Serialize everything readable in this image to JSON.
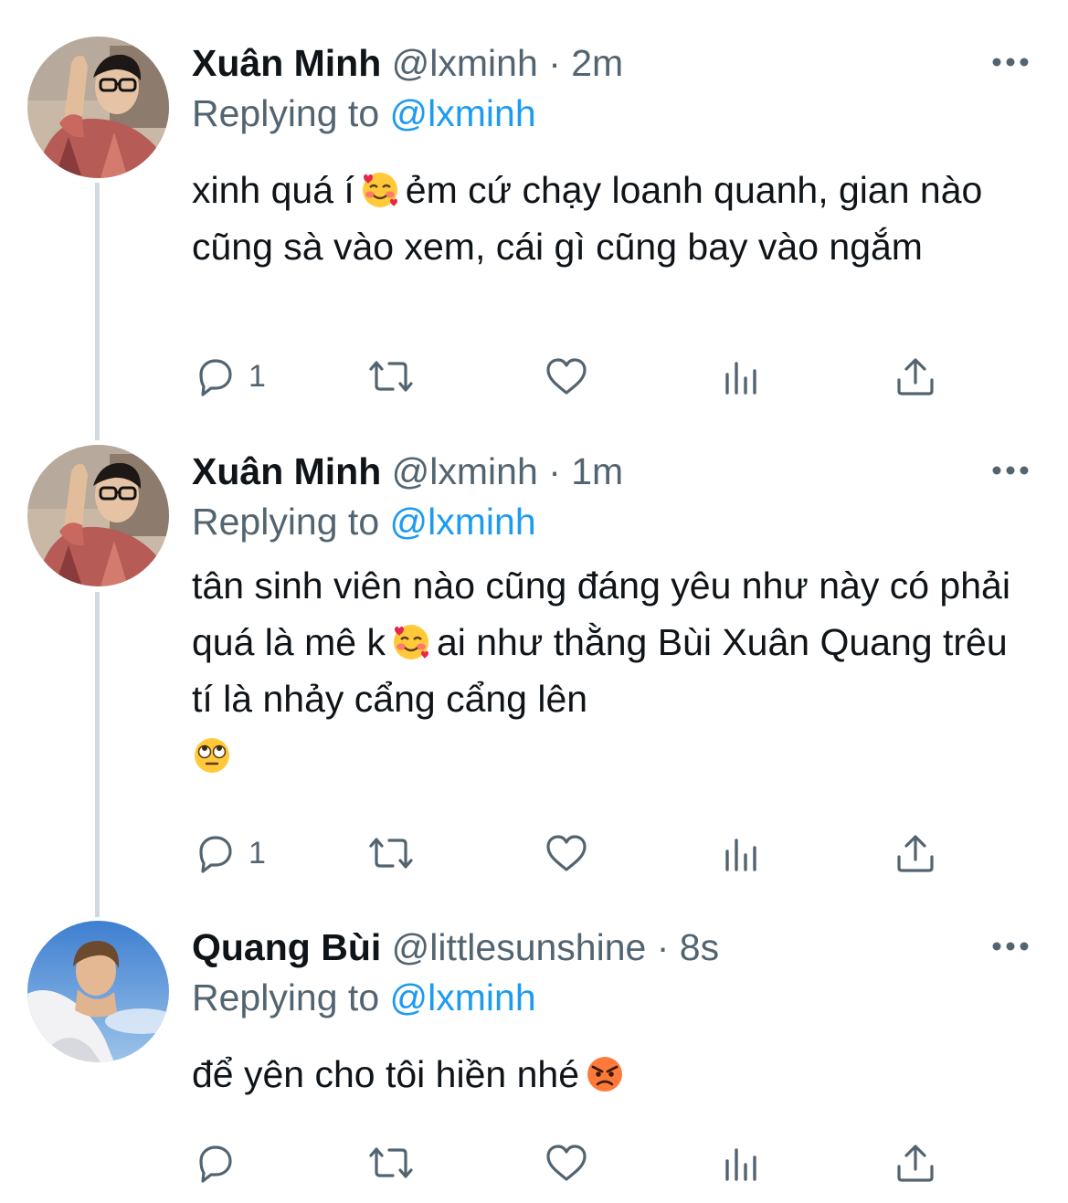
{
  "tweets": [
    {
      "name": "Xuân Minh",
      "handle": "@lxminh",
      "dot": "·",
      "time": "2m",
      "replying_prefix": "Replying to",
      "replying_to": "@lxminh",
      "text_before_emoji": "xinh quá í",
      "text_after_emoji": "ẻm cứ chạy loanh quanh, gian nào cũng sà vào xem, cái gì cũng bay vào ngắm",
      "emoji": "smiling-face-with-hearts",
      "reply_count": "1"
    },
    {
      "name": "Xuân Minh",
      "handle": "@lxminh",
      "dot": "·",
      "time": "1m",
      "replying_prefix": "Replying to",
      "replying_to": "@lxminh",
      "text_before_emoji": "tân sinh viên nào cũng đáng yêu như này có phải quá là mê k",
      "text_after_emoji": "ai như thằng Bùi Xuân Quang trêu tí là nhảy cẩng cẩng lên",
      "emoji": "smiling-face-with-hearts",
      "emoji_end": "face-with-rolling-eyes",
      "reply_count": "1"
    },
    {
      "name": "Quang Bùi",
      "handle": "@littlesunshine",
      "dot": "·",
      "time": "8s",
      "replying_prefix": "Replying to",
      "replying_to": "@lxminh",
      "text_before_emoji": "để yên cho tôi hiền nhé",
      "emoji": "angry-face",
      "reply_count": ""
    }
  ],
  "colors": {
    "text": "#0f1419",
    "secondary": "#536471",
    "mention": "#1d9bf0",
    "thread_line": "#cfd9de"
  },
  "icons": [
    "reply-icon",
    "retweet-icon",
    "like-icon",
    "analytics-icon",
    "share-icon",
    "more-options-icon"
  ]
}
